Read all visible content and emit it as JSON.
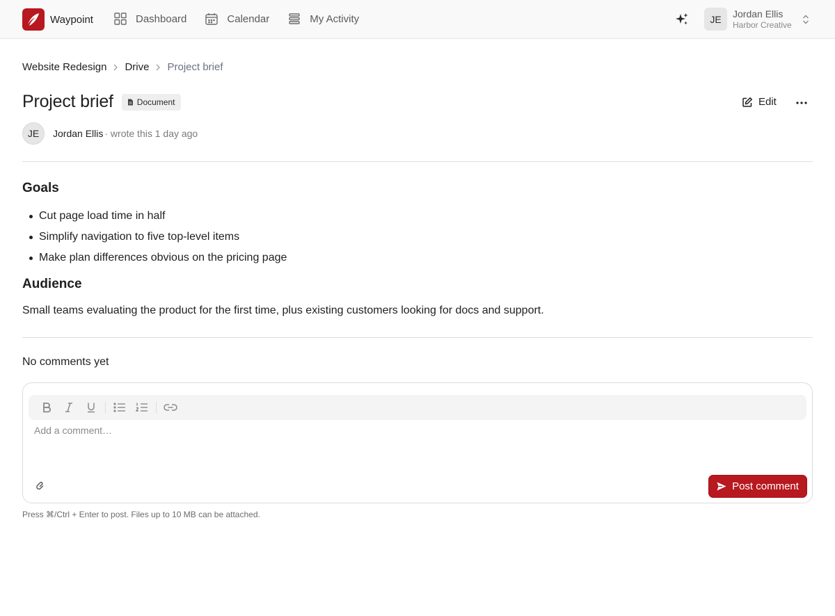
{
  "app": {
    "name": "Waypoint"
  },
  "colors": {
    "accent": "#b8181f",
    "muted": "#6b7280",
    "border": "#dedede"
  },
  "nav": [
    {
      "label": "Dashboard",
      "icon": "grid-icon"
    },
    {
      "label": "Calendar",
      "icon": "calendar-icon"
    },
    {
      "label": "My Activity",
      "icon": "activity-icon"
    }
  ],
  "account": {
    "initials": "JE",
    "name": "Jordan Ellis",
    "org": "Harbor Creative"
  },
  "breadcrumb": [
    "Website Redesign",
    "Drive",
    "Project brief"
  ],
  "page": {
    "title": "Project brief",
    "type_badge": "Document",
    "edit_label": "Edit"
  },
  "author": {
    "initials": "JE",
    "name": "Jordan Ellis",
    "meta": "· wrote this 1 day ago"
  },
  "document": {
    "sections": [
      {
        "heading": "Goals",
        "bullets": [
          "Cut page load time in half",
          "Simplify navigation to five top-level items",
          "Make plan differences obvious on the pricing page"
        ]
      },
      {
        "heading": "Audience",
        "paragraph": "Small teams evaluating the product for the first time, plus existing customers looking for docs and support."
      }
    ]
  },
  "comments": {
    "empty_title": "No comments yet",
    "placeholder": "Add a comment…",
    "post_label": "Post comment",
    "hint": "Press ⌘/Ctrl + Enter to post. Files up to 10 MB can be attached."
  }
}
